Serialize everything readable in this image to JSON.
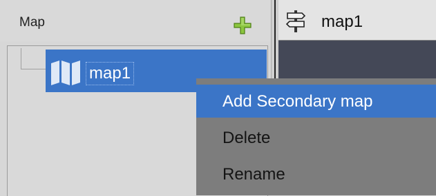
{
  "left_panel": {
    "title": "Map",
    "add_icon": "plus-icon",
    "tree": {
      "items": [
        {
          "label": "map1",
          "icon": "map-icon",
          "selected": true
        }
      ]
    }
  },
  "right_panel": {
    "tab": {
      "label": "map1",
      "icon": "signpost-icon"
    }
  },
  "context_menu": {
    "items": [
      {
        "label": "Add Secondary map",
        "highlighted": true
      },
      {
        "label": "Delete",
        "highlighted": false
      },
      {
        "label": "Rename",
        "highlighted": false
      }
    ]
  },
  "colors": {
    "selection": "#3b75c7",
    "plus_icon": "#8cc63f",
    "canvas": "#444857",
    "menu_bg": "#7d7d7d"
  }
}
